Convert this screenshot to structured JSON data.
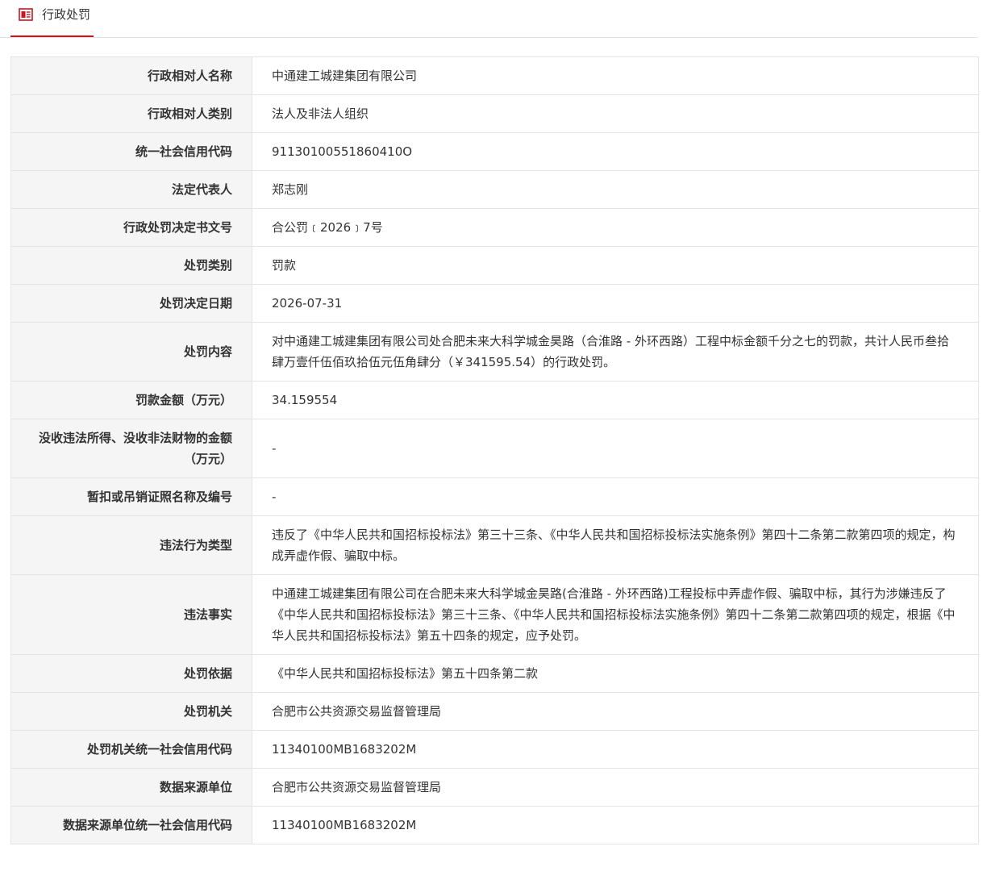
{
  "header": {
    "tab_label": "行政处罚",
    "tab_icon": "document-icon",
    "accent_color": "#c8161d"
  },
  "rows": [
    {
      "label": "行政相对人名称",
      "value": "中通建工城建集团有限公司"
    },
    {
      "label": "行政相对人类别",
      "value": "法人及非法人组织"
    },
    {
      "label": "统一社会信用代码",
      "value": "91130100551860410O"
    },
    {
      "label": "法定代表人",
      "value": "郑志刚"
    },
    {
      "label": "行政处罚决定书文号",
      "value": "合公罚﹝2026﹞7号"
    },
    {
      "label": "处罚类别",
      "value": "罚款"
    },
    {
      "label": "处罚决定日期",
      "value": "2026-07-31"
    },
    {
      "label": "处罚内容",
      "value": "对中通建工城建集团有限公司处合肥未来大科学城金昊路（合淮路 - 外环西路）工程中标金额千分之七的罚款，共计人民币叁拾肆万壹仟伍佰玖拾伍元伍角肆分（￥341595.54）的行政处罚。"
    },
    {
      "label": "罚款金额（万元）",
      "value": "34.159554"
    },
    {
      "label": "没收违法所得、没收非法财物的金额（万元）",
      "value": "-"
    },
    {
      "label": "暂扣或吊销证照名称及编号",
      "value": "-"
    },
    {
      "label": "违法行为类型",
      "value": "违反了《中华人民共和国招标投标法》第三十三条、《中华人民共和国招标投标法实施条例》第四十二条第二款第四项的规定，构成弄虚作假、骗取中标。"
    },
    {
      "label": "违法事实",
      "value": "中通建工城建集团有限公司在合肥未来大科学城金昊路(合淮路 - 外环西路)工程投标中弄虚作假、骗取中标，其行为涉嫌违反了《中华人民共和国招标投标法》第三十三条、《中华人民共和国招标投标法实施条例》第四十二条第二款第四项的规定，根据《中华人民共和国招标投标法》第五十四条的规定，应予处罚。"
    },
    {
      "label": "处罚依据",
      "value": "《中华人民共和国招标投标法》第五十四条第二款"
    },
    {
      "label": "处罚机关",
      "value": "合肥市公共资源交易监督管理局"
    },
    {
      "label": "处罚机关统一社会信用代码",
      "value": "11340100MB1683202M"
    },
    {
      "label": "数据来源单位",
      "value": "合肥市公共资源交易监督管理局"
    },
    {
      "label": "数据来源单位统一社会信用代码",
      "value": "11340100MB1683202M"
    }
  ]
}
